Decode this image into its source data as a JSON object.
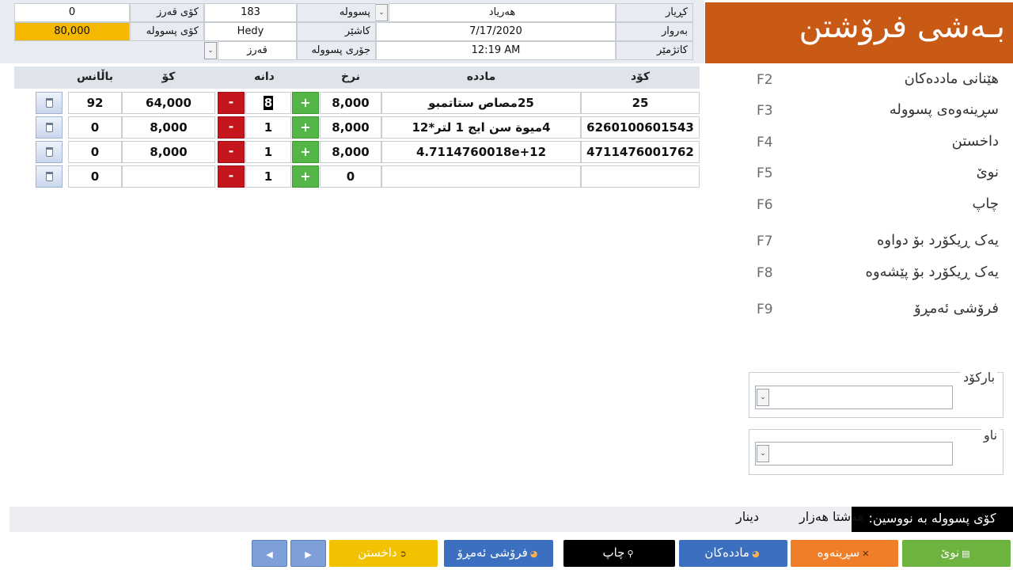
{
  "header": {
    "title": "بـەشی فرۆشتن",
    "customer_label": "کڕیار",
    "customer_value": "هەریاد",
    "date_label": "بەروار",
    "date_value": "7/17/2020",
    "time_label": "کاتژمێر",
    "time_value": "12:19 AM",
    "invoice_label": "پسوولە",
    "invoice_value": "183",
    "cashier_label": "کاشێر",
    "cashier_value": "Hedy",
    "invoice_type_label": "جۆری پسوولە",
    "invoice_type_value": "قەرز",
    "debt_total_label": "کۆی قەرز",
    "debt_total_value": "0",
    "invoice_total_label": "کۆی پسوولە",
    "invoice_total_value": "80,000"
  },
  "grid": {
    "columns": {
      "code": "کۆد",
      "item": "مادده",
      "price": "نرخ",
      "qty": "دانە",
      "total": "کۆ",
      "balance": "باڵانس"
    },
    "plus_label": "+",
    "minus_label": "-",
    "rows": [
      {
        "code": "25",
        "item": "25مصاص ستاتمبو",
        "price": "8,000",
        "qty": "8",
        "total": "64,000",
        "balance": "92"
      },
      {
        "code": "6260100601543",
        "item": "4میوة سن ایج 1 لتر*12",
        "price": "8,000",
        "qty": "1",
        "total": "8,000",
        "balance": "0"
      },
      {
        "code": "4711476001762",
        "item": "4.7114760018e+12",
        "price": "8,000",
        "qty": "1",
        "total": "8,000",
        "balance": "0"
      },
      {
        "code": "",
        "item": "",
        "price": "0",
        "qty": "1",
        "total": "",
        "balance": "0"
      }
    ]
  },
  "shortcuts": [
    {
      "key": "F2",
      "label": "هێنانی ماددەکان"
    },
    {
      "key": "F3",
      "label": "سڕینەوەی پسوولە"
    },
    {
      "key": "F4",
      "label": "داخستن"
    },
    {
      "key": "F5",
      "label": "نوێ"
    },
    {
      "key": "F6",
      "label": "چاپ"
    },
    {
      "key": "F7",
      "label": "یەک ڕیکۆرد بۆ دواوە"
    },
    {
      "key": "F8",
      "label": "یەک ڕیکۆرد بۆ پێشەوە"
    },
    {
      "key": "F9",
      "label": "فرۆشی ئەمڕۆ"
    }
  ],
  "search": {
    "barcode_label": "بارکۆد",
    "name_label": "ناو"
  },
  "footer": {
    "words_label": "کۆی پسوولە بە نووسین:",
    "words_value": "هەشتا هەزار",
    "currency": "دینار"
  },
  "buttons": {
    "new": "نوێ",
    "delete": "سڕینەوە",
    "items": "ماددەکان",
    "print": "چاپ",
    "today_sales": "فرۆشی ئەمڕۆ",
    "close": "داخستن"
  },
  "colors": {
    "title_bg": "#c85a16",
    "green": "#6db33f",
    "orange": "#f07d28",
    "blue": "#3d6fc0",
    "black": "#000000",
    "yellow": "#f2c200",
    "nav": "#7f9fd8",
    "invoice_total_bg": "#f5b800"
  }
}
